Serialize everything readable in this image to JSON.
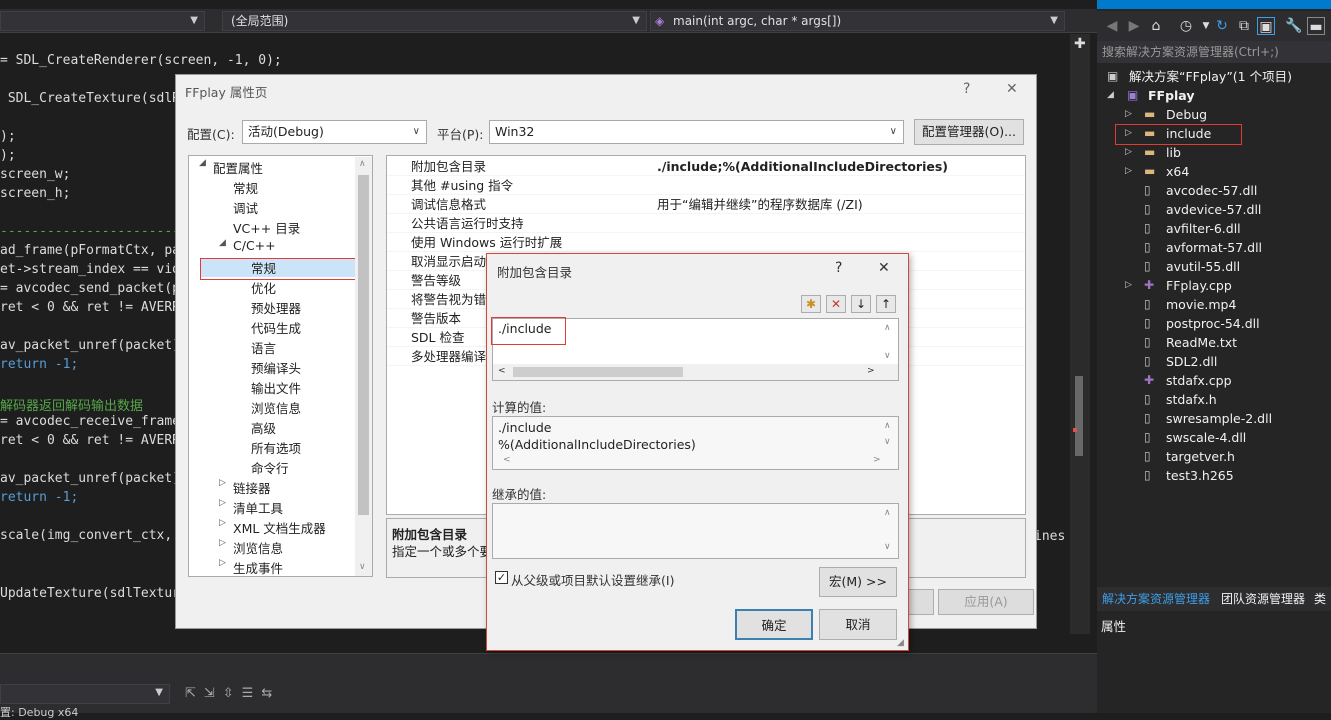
{
  "editor": {
    "scope_dropdown": "(全局范围)",
    "func_dropdown": "main(int argc, char * args[])",
    "code_lines": [
      {
        "t": "= SDL_CreateRenderer(screen, -1, 0);",
        "c": "n"
      },
      {
        "t": " SDL_CreateTexture(sdlRe",
        "c": "n"
      },
      {
        "t": ");",
        "c": "n"
      },
      {
        "t": ");",
        "c": "n"
      },
      {
        "t": "screen_w;",
        "c": "n"
      },
      {
        "t": "screen_h;",
        "c": "n"
      },
      {
        "t": "-----------------------------",
        "c": "cm"
      },
      {
        "t": "ad_frame(pFormatCtx, pac",
        "c": "n"
      },
      {
        "t": "et->stream_index == vide",
        "c": "n"
      },
      {
        "t": "= avcodec_send_packet(p",
        "c": "n"
      },
      {
        "t": "ret < 0 && ret != AVERRO",
        "c": "n"
      },
      {
        "t": "av_packet_unref(packet)",
        "c": "n"
      },
      {
        "t": "return -1;",
        "c": "kw"
      },
      {
        "t": "解码器返回解码输出数据",
        "c": "cm"
      },
      {
        "t": "= avcodec_receive_frame",
        "c": "n"
      },
      {
        "t": "ret < 0 && ret != AVERRO",
        "c": "n"
      },
      {
        "t": "av_packet_unref(packet)",
        "c": "n"
      },
      {
        "t": "return -1;",
        "c": "kw"
      },
      {
        "t": "scale(img_convert_ctx,",
        "c": "n"
      },
      {
        "t": "UpdateTexture(sdlTexture",
        "c": "n"
      }
    ],
    "code_right_fragment": "ines",
    "status_text": "置: Debug x64"
  },
  "solution": {
    "search_placeholder": "搜索解决方案资源管理器(Ctrl+;)",
    "root": "解决方案“FFplay”(1 个项目)",
    "project": "FFplay",
    "items": [
      {
        "label": "Debug",
        "kind": "folder",
        "expand": true
      },
      {
        "label": "include",
        "kind": "folder",
        "expand": true
      },
      {
        "label": "lib",
        "kind": "folder",
        "expand": true
      },
      {
        "label": "x64",
        "kind": "folder",
        "expand": true
      },
      {
        "label": "avcodec-57.dll",
        "kind": "file"
      },
      {
        "label": "avdevice-57.dll",
        "kind": "file"
      },
      {
        "label": "avfilter-6.dll",
        "kind": "file"
      },
      {
        "label": "avformat-57.dll",
        "kind": "file"
      },
      {
        "label": "avutil-55.dll",
        "kind": "file"
      },
      {
        "label": "FFplay.cpp",
        "kind": "cpp",
        "expand": true
      },
      {
        "label": "movie.mp4",
        "kind": "file"
      },
      {
        "label": "postproc-54.dll",
        "kind": "file"
      },
      {
        "label": "ReadMe.txt",
        "kind": "file"
      },
      {
        "label": "SDL2.dll",
        "kind": "file"
      },
      {
        "label": "stdafx.cpp",
        "kind": "cpp"
      },
      {
        "label": "stdafx.h",
        "kind": "file"
      },
      {
        "label": "swresample-2.dll",
        "kind": "file"
      },
      {
        "label": "swscale-4.dll",
        "kind": "file"
      },
      {
        "label": "targetver.h",
        "kind": "file"
      },
      {
        "label": "test3.h265",
        "kind": "file"
      }
    ],
    "tabs": [
      "解决方案资源管理器",
      "团队资源管理器",
      "类"
    ],
    "properties_title": "属性"
  },
  "propdlg": {
    "title": "FFplay 属性页",
    "help": "?",
    "close": "✕",
    "config_label": "配置(C):",
    "config_value": "活动(Debug)",
    "platform_label": "平台(P):",
    "platform_value": "Win32",
    "config_manager": "配置管理器(O)...",
    "tree": [
      {
        "label": "配置属性",
        "level": 0,
        "exp": "◢"
      },
      {
        "label": "常规",
        "level": 1
      },
      {
        "label": "调试",
        "level": 1
      },
      {
        "label": "VC++ 目录",
        "level": 1
      },
      {
        "label": "C/C++",
        "level": 1,
        "exp": "◢"
      },
      {
        "label": "常规",
        "level": 2,
        "sel": true
      },
      {
        "label": "优化",
        "level": 2
      },
      {
        "label": "预处理器",
        "level": 2
      },
      {
        "label": "代码生成",
        "level": 2
      },
      {
        "label": "语言",
        "level": 2
      },
      {
        "label": "预编译头",
        "level": 2
      },
      {
        "label": "输出文件",
        "level": 2
      },
      {
        "label": "浏览信息",
        "level": 2
      },
      {
        "label": "高级",
        "level": 2
      },
      {
        "label": "所有选项",
        "level": 2
      },
      {
        "label": "命令行",
        "level": 2
      },
      {
        "label": "链接器",
        "level": 1,
        "exp": "▷"
      },
      {
        "label": "清单工具",
        "level": 1,
        "exp": "▷"
      },
      {
        "label": "XML 文档生成器",
        "level": 1,
        "exp": "▷"
      },
      {
        "label": "浏览信息",
        "level": 1,
        "exp": "▷"
      },
      {
        "label": "生成事件",
        "level": 1,
        "exp": "▷"
      }
    ],
    "props": [
      {
        "name": "附加包含目录",
        "value": "./include;%(AdditionalIncludeDirectories)",
        "bold": true
      },
      {
        "name": "其他 #using 指令",
        "value": ""
      },
      {
        "name": "调试信息格式",
        "value": "用于“编辑并继续”的程序数据库 (/ZI)"
      },
      {
        "name": "公共语言运行时支持",
        "value": ""
      },
      {
        "name": "使用 Windows 运行时扩展",
        "value": ""
      },
      {
        "name": "取消显示启动版",
        "value": ""
      },
      {
        "name": "警告等级",
        "value": ""
      },
      {
        "name": "将警告视为错误",
        "value": ""
      },
      {
        "name": "警告版本",
        "value": ""
      },
      {
        "name": "SDL 检查",
        "value": ""
      },
      {
        "name": "多处理器编译",
        "value": ""
      }
    ],
    "desc_title": "附加包含目录",
    "desc_text": "指定一个或多个要",
    "apply": "应用(A)"
  },
  "incdlg": {
    "title": "附加包含目录",
    "help": "?",
    "close": "✕",
    "entry": "./include",
    "computed_label": "计算的值:",
    "computed_lines": [
      "./include",
      "%(AdditionalIncludeDirectories)"
    ],
    "inherited_label": "继承的值:",
    "inherit_checkbox": "从父级或项目默认设置继承(I)",
    "macro_button": "宏(M) >>",
    "ok": "确定",
    "cancel": "取消"
  }
}
